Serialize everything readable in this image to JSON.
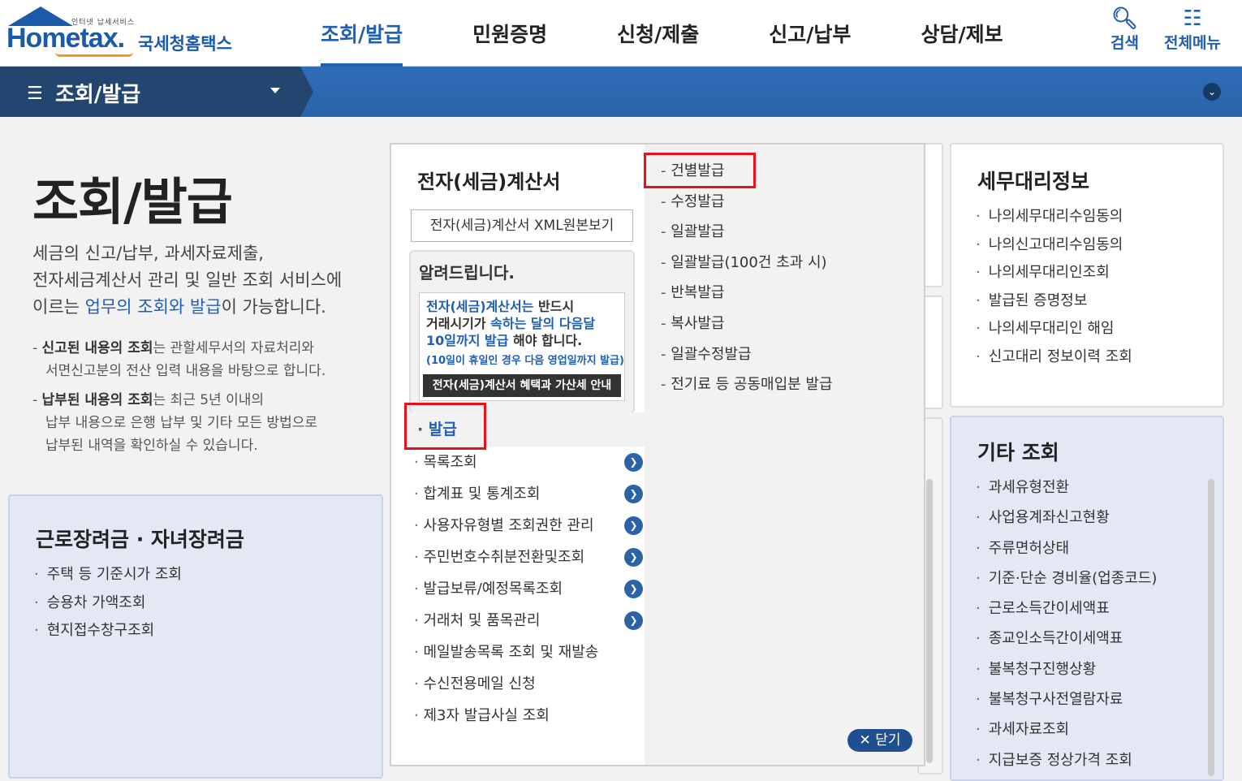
{
  "header": {
    "logo_small": "인터넷 납세서비스",
    "logo_home": "Hometax.",
    "logo_ko": "국세청홈택스",
    "gnb": [
      "조회/발급",
      "민원증명",
      "신청/제출",
      "신고/납부",
      "상담/제보"
    ],
    "search_label": "검색",
    "allmenu_label": "전체메뉴"
  },
  "subbar": {
    "title": "조회/발급"
  },
  "hero": {
    "title": "조회/발급",
    "desc_1": "세금의 신고/납부, 과세자료제출,",
    "desc_2": "전자세금계산서 관리 및 일반 조회 서비스에",
    "desc_3a": "이르는 ",
    "desc_3b": "업무의 조회와 발급",
    "desc_3c": "이 가능합니다.",
    "note1_b": "신고된 내용의 조회",
    "note1_t": "는 관할세무서의 자료처리와",
    "note1_2": "서면신고분의 전산 입력 내용을 바탕으로 합니다.",
    "note2_b": "납부된 내용의 조회",
    "note2_t": "는 최근 5년 이내의",
    "note2_2": "납부 내용으로 은행 납부 및 기타 모든 방법으로",
    "note2_3": "납부된 내역을 확인하실 수 있습니다."
  },
  "eitc": {
    "title": "근로장려금 · 자녀장려금",
    "items": [
      "주택 등 기준시가 조회",
      "승용차 가액조회",
      "현지접수창구조회"
    ]
  },
  "panel": {
    "title": "전자(세금)계산서",
    "xml_button": "전자(세금)계산서 XML원본보기",
    "notice_head": "알려드립니다.",
    "notice_1a": "전자(세금)계산서는",
    "notice_1b": " 반드시",
    "notice_2a": "거래시기가 ",
    "notice_2b": "속하는 달의 다음달",
    "notice_3a": "10일까지 발급",
    "notice_3b": " 해야 합니다.",
    "notice_sub": "(10일이 휴일인 경우 다음 영업일까지 발급)",
    "notice_button": "전자(세금)계산서 혜택과 가산세 안내",
    "selected_group": "발급",
    "groups": [
      {
        "label": "목록조회",
        "arrow": true
      },
      {
        "label": "합계표 및 통계조회",
        "arrow": true
      },
      {
        "label": "사용자유형별 조회권한 관리",
        "arrow": true
      },
      {
        "label": "주민번호수취분전환및조회",
        "arrow": true
      },
      {
        "label": "발급보류/예정목록조회",
        "arrow": true
      },
      {
        "label": "거래처 및 품목관리",
        "arrow": true
      },
      {
        "label": "메일발송목록 조회 및 재발송",
        "arrow": false
      },
      {
        "label": "수신전용메일 신청",
        "arrow": false
      },
      {
        "label": "제3자 발급사실 조회",
        "arrow": false
      }
    ],
    "sub_items": [
      "건별발급",
      "수정발급",
      "일괄발급",
      "일괄발급(100건 초과 시)",
      "반복발급",
      "복사발급",
      "일괄수정발급",
      "전기료 등 공동매입분 발급"
    ],
    "close_label": "닫기"
  },
  "tax_agent": {
    "title": "세무대리정보",
    "items": [
      "나의세무대리수임동의",
      "나의신고대리수임동의",
      "나의세무대리인조회",
      "발급된 증명정보",
      "나의세무대리인 해임",
      "신고대리 정보이력 조회"
    ]
  },
  "other": {
    "title": "기타 조회",
    "items": [
      "과세유형전환",
      "사업용계좌신고현황",
      "주류면허상태",
      "기준·단순 경비율(업종코드)",
      "근로소득간이세액표",
      "종교인소득간이세액표",
      "불복청구진행상황",
      "불복청구사전열람자료",
      "과세자료조회",
      "지급보증 정상가격 조회"
    ]
  }
}
